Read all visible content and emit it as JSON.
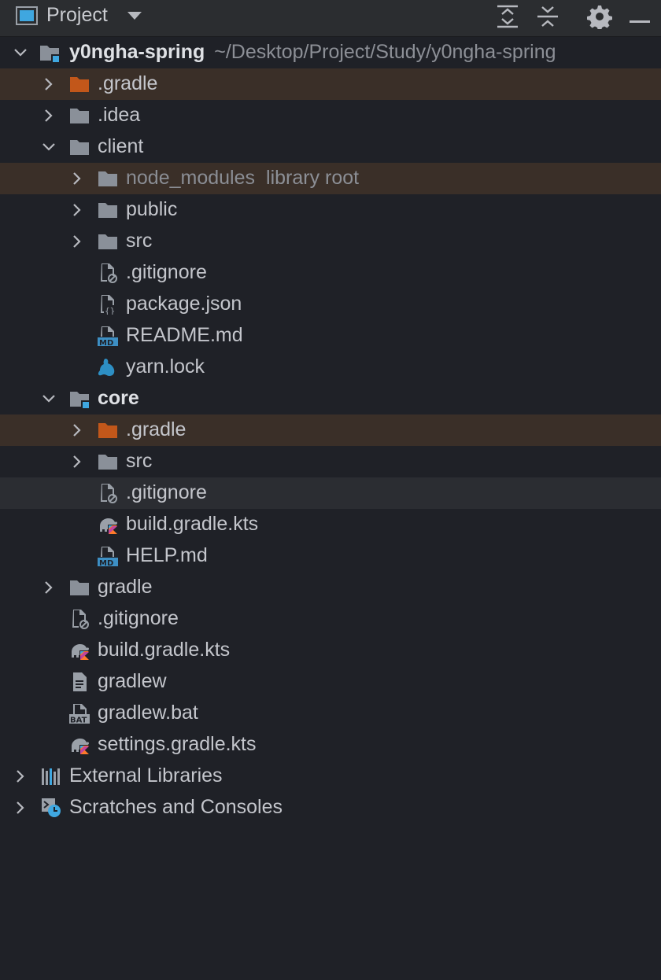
{
  "header": {
    "title": "Project",
    "tools": [
      "expand-all-icon",
      "collapse-all-icon",
      "gear-icon",
      "minimize-icon"
    ]
  },
  "colors": {
    "background": "#1f2127",
    "folder": "#8a9099",
    "folder_excluded": "#c2571a",
    "module_badge": "#3fa7e0",
    "row_highlight_orange": "#3a2f28",
    "row_highlight_grey": "#2b2d32"
  },
  "tree": [
    {
      "label": "y0ngha-spring",
      "path": "~/Desktop/Project/Study/y0ngha-spring",
      "icon": "module-folder-icon",
      "expanded": true
    },
    {
      "label": ".gradle",
      "icon": "excluded-folder-icon",
      "expanded": false
    },
    {
      "label": ".idea",
      "icon": "folder-icon",
      "expanded": false
    },
    {
      "label": "client",
      "icon": "folder-icon",
      "expanded": true
    },
    {
      "label": "node_modules",
      "suffix": "library root",
      "icon": "folder-icon",
      "expanded": false
    },
    {
      "label": "public",
      "icon": "folder-icon",
      "expanded": false
    },
    {
      "label": "src",
      "icon": "folder-icon",
      "expanded": false
    },
    {
      "label": ".gitignore",
      "icon": "gitignore-file-icon"
    },
    {
      "label": "package.json",
      "icon": "json-file-icon"
    },
    {
      "label": "README.md",
      "icon": "markdown-file-icon"
    },
    {
      "label": "yarn.lock",
      "icon": "yarn-file-icon"
    },
    {
      "label": "core",
      "icon": "module-folder-icon",
      "expanded": true
    },
    {
      "label": ".gradle",
      "icon": "excluded-folder-icon",
      "expanded": false
    },
    {
      "label": "src",
      "icon": "folder-icon",
      "expanded": false
    },
    {
      "label": ".gitignore",
      "icon": "gitignore-file-icon"
    },
    {
      "label": "build.gradle.kts",
      "icon": "gradle-kotlin-file-icon"
    },
    {
      "label": "HELP.md",
      "icon": "markdown-file-icon"
    },
    {
      "label": "gradle",
      "icon": "folder-icon",
      "expanded": false
    },
    {
      "label": ".gitignore",
      "icon": "gitignore-file-icon"
    },
    {
      "label": "build.gradle.kts",
      "icon": "gradle-kotlin-file-icon"
    },
    {
      "label": "gradlew",
      "icon": "text-file-icon"
    },
    {
      "label": "gradlew.bat",
      "icon": "bat-file-icon"
    },
    {
      "label": "settings.gradle.kts",
      "icon": "gradle-kotlin-file-icon"
    },
    {
      "label": "External Libraries",
      "icon": "libraries-icon",
      "expanded": false
    },
    {
      "label": "Scratches and Consoles",
      "icon": "scratches-icon",
      "expanded": false
    }
  ]
}
